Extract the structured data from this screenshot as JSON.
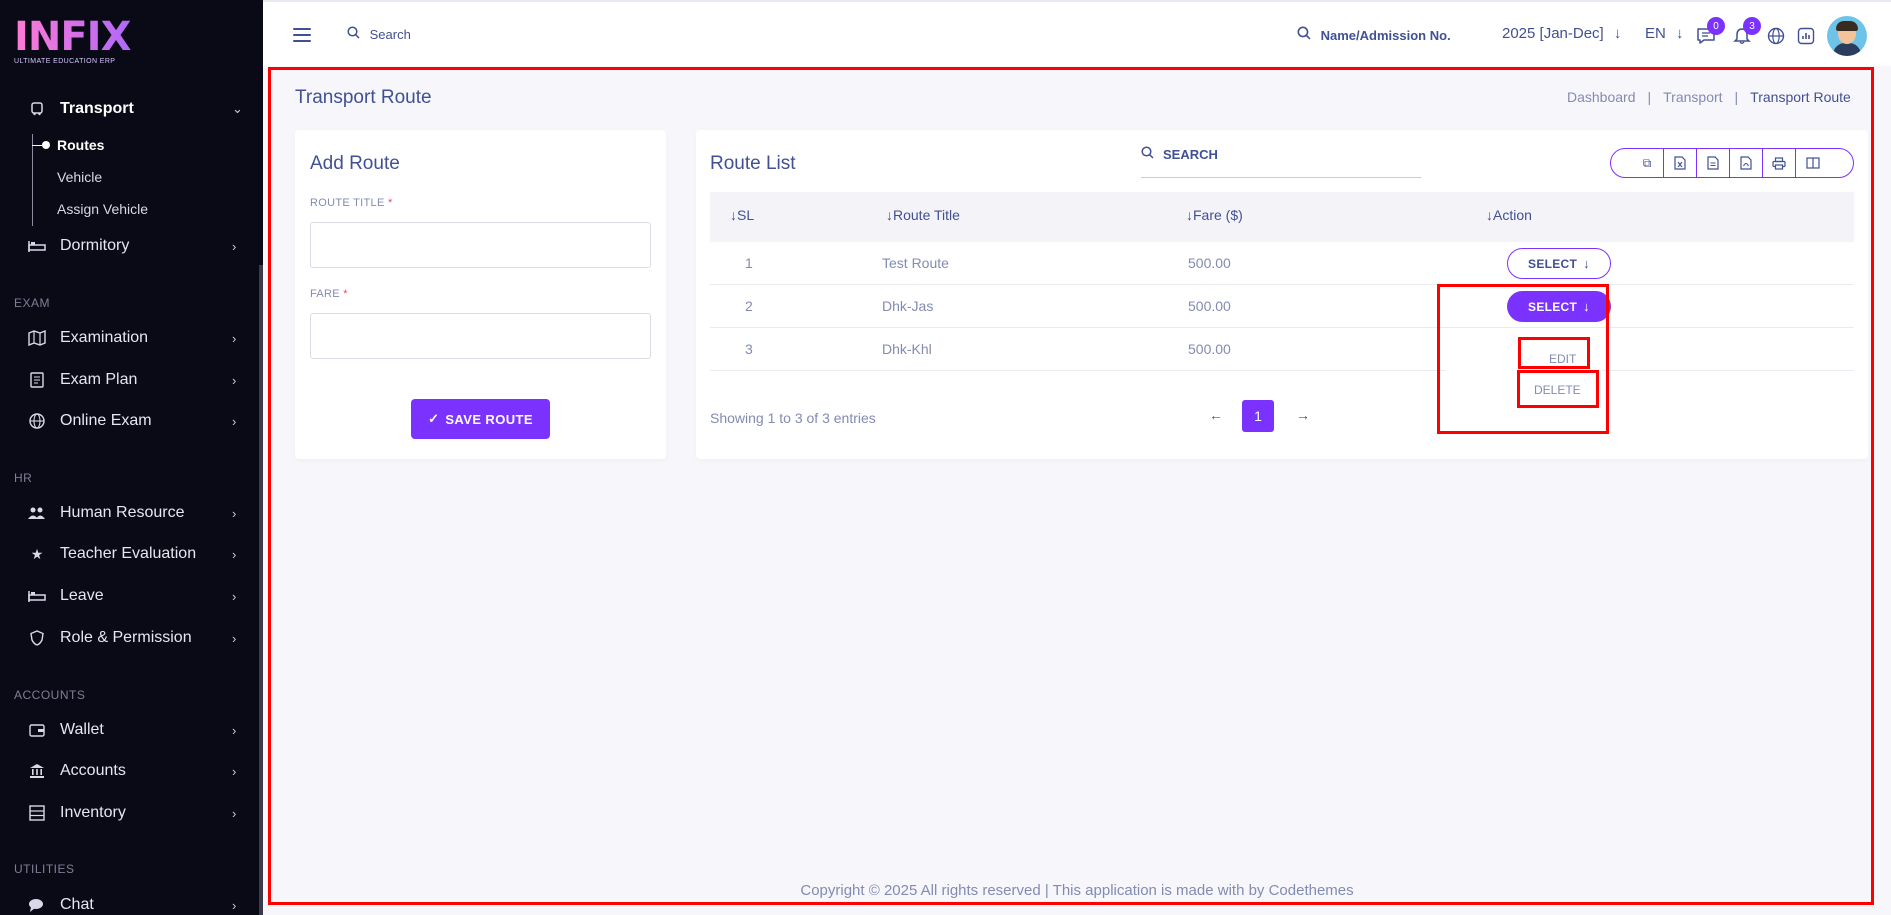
{
  "brand": {
    "logo_text": "INFIX",
    "logo_sub": "ULTIMATE EDUCATION ERP"
  },
  "sidebar": {
    "transport": {
      "label": "Transport",
      "sub": {
        "routes": "Routes",
        "vehicle": "Vehicle",
        "assign": "Assign Vehicle"
      }
    },
    "dormitory": "Dormitory",
    "sec_exam": "EXAM",
    "examination": "Examination",
    "exam_plan": "Exam Plan",
    "online_exam": "Online Exam",
    "sec_hr": "HR",
    "human_resource": "Human Resource",
    "teacher_eval": "Teacher Evaluation",
    "leave": "Leave",
    "role_perm": "Role & Permission",
    "sec_accounts": "ACCOUNTS",
    "wallet": "Wallet",
    "accounts": "Accounts",
    "inventory": "Inventory",
    "sec_utilities": "UTILITIES",
    "chat": "Chat"
  },
  "topbar": {
    "search": "Search",
    "search_student": "Name/Admission No.",
    "year": "2025 [Jan-Dec]",
    "lang": "EN",
    "msg_count": "0",
    "notif_count": "3"
  },
  "page": {
    "title": "Transport Route",
    "breadcrumb": {
      "dashboard": "Dashboard",
      "transport": "Transport",
      "current": "Transport Route"
    }
  },
  "add_route": {
    "title": "Add Route",
    "route_title_label": "ROUTE TITLE",
    "fare_label": "FARE",
    "required_mark": "*",
    "save_label": "SAVE ROUTE",
    "save_check": "✓"
  },
  "route_list": {
    "title": "Route List",
    "search_placeholder": "SEARCH",
    "columns": {
      "sl": "SL",
      "route_title": "Route Title",
      "fare": "Fare ($)",
      "action": "Action"
    },
    "rows": [
      {
        "sl": "1",
        "title": "Test Route",
        "fare": "500.00"
      },
      {
        "sl": "2",
        "title": "Dhk-Jas",
        "fare": "500.00"
      },
      {
        "sl": "3",
        "title": "Dhk-Khl",
        "fare": "500.00"
      }
    ],
    "select_label": "SELECT",
    "dropdown": {
      "edit": "EDIT",
      "delete": "DELETE"
    },
    "showing": "Showing 1 to 3 of 3 entries",
    "page_current": "1"
  },
  "footer": "Copyright © 2025 All rights reserved | This application is made with by Codethemes",
  "colors": {
    "accent": "#7c32ff",
    "text": "#415094",
    "muted": "#828bb2",
    "sidebar_bg": "#0a0a16",
    "highlight": "#ff0000"
  }
}
